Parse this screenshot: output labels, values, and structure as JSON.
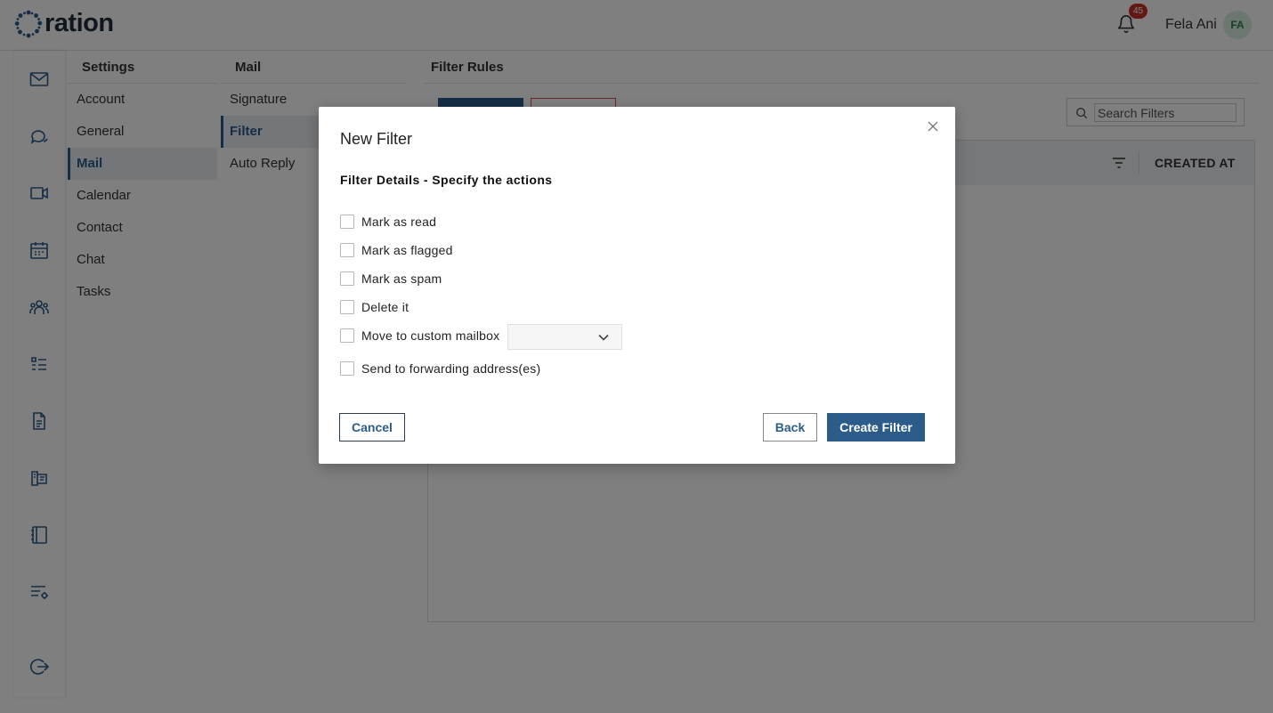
{
  "app": {
    "logo_text": "ration",
    "notification_count": "45",
    "user_name": "Fela Ani",
    "user_initials": "FA"
  },
  "rail": {
    "icons": [
      "mail-icon",
      "chat-icon",
      "video-icon",
      "calendar-icon",
      "contacts-icon",
      "tasks-icon",
      "document-icon",
      "notes-icon",
      "notebook-icon",
      "settings-list-icon",
      "logout-icon"
    ]
  },
  "settings": {
    "header": "Settings",
    "items": [
      "Account",
      "General",
      "Mail",
      "Calendar",
      "Contact",
      "Chat",
      "Tasks"
    ],
    "active": "Mail"
  },
  "mail": {
    "header": "Mail",
    "items": [
      "Signature",
      "Filter",
      "Auto Reply"
    ],
    "active": "Filter"
  },
  "main": {
    "title": "Filter Rules",
    "search_placeholder": "Search Filters",
    "column_created_at": "CREATED AT"
  },
  "modal": {
    "title": "New Filter",
    "subtitle": "Filter Details - Specify the actions",
    "options": [
      {
        "label": "Mark as read",
        "checked": false
      },
      {
        "label": "Mark as flagged",
        "checked": false
      },
      {
        "label": "Mark as spam",
        "checked": false
      },
      {
        "label": "Delete it",
        "checked": false
      },
      {
        "label": "Move to custom mailbox",
        "checked": false
      },
      {
        "label": "Send to forwarding address(es)",
        "checked": false
      }
    ],
    "mailbox_select_value": "",
    "cancel_label": "Cancel",
    "back_label": "Back",
    "create_label": "Create Filter"
  },
  "colors": {
    "primary": "#2c5d8a",
    "danger": "#d9534f",
    "badge": "#c9302c"
  }
}
